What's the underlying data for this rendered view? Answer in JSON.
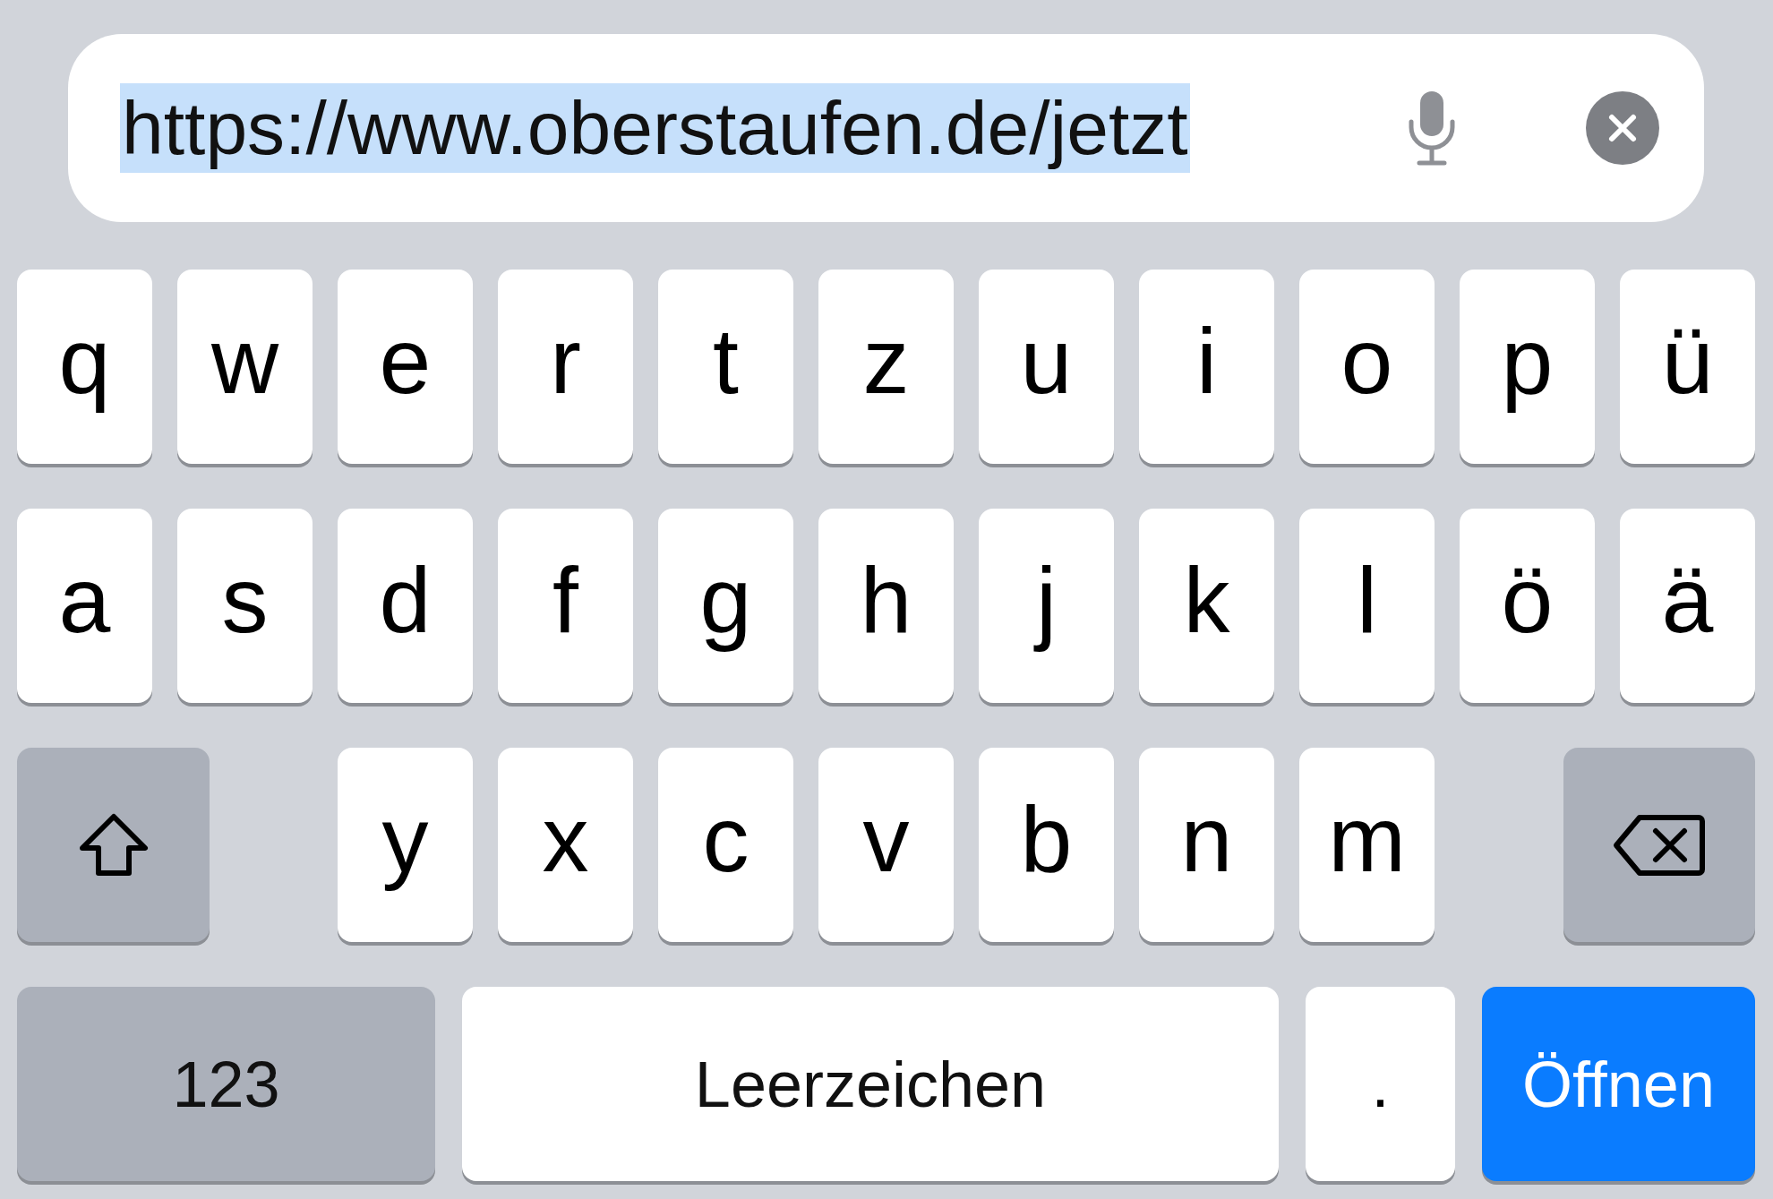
{
  "url_bar": {
    "value": "https://www.oberstaufen.de/jetzt",
    "selected": true
  },
  "keyboard": {
    "letter_row_1": [
      "q",
      "w",
      "e",
      "r",
      "t",
      "z",
      "u",
      "i",
      "o",
      "p",
      "ü"
    ],
    "letter_row_2": [
      "a",
      "s",
      "d",
      "f",
      "g",
      "h",
      "j",
      "k",
      "l",
      "ö",
      "ä"
    ],
    "letter_row_3": {
      "left_key": {
        "kind": "shift"
      },
      "letters": [
        "y",
        "x",
        "c",
        "v",
        "b",
        "n",
        "m"
      ],
      "right_key": {
        "kind": "backspace"
      }
    },
    "bottom_row": [
      {
        "kind": "numbers",
        "label": "123"
      },
      {
        "kind": "space",
        "label": "Leerzeichen"
      },
      {
        "kind": "period",
        "label": "."
      },
      {
        "kind": "go",
        "label": "Öffnen"
      }
    ]
  }
}
